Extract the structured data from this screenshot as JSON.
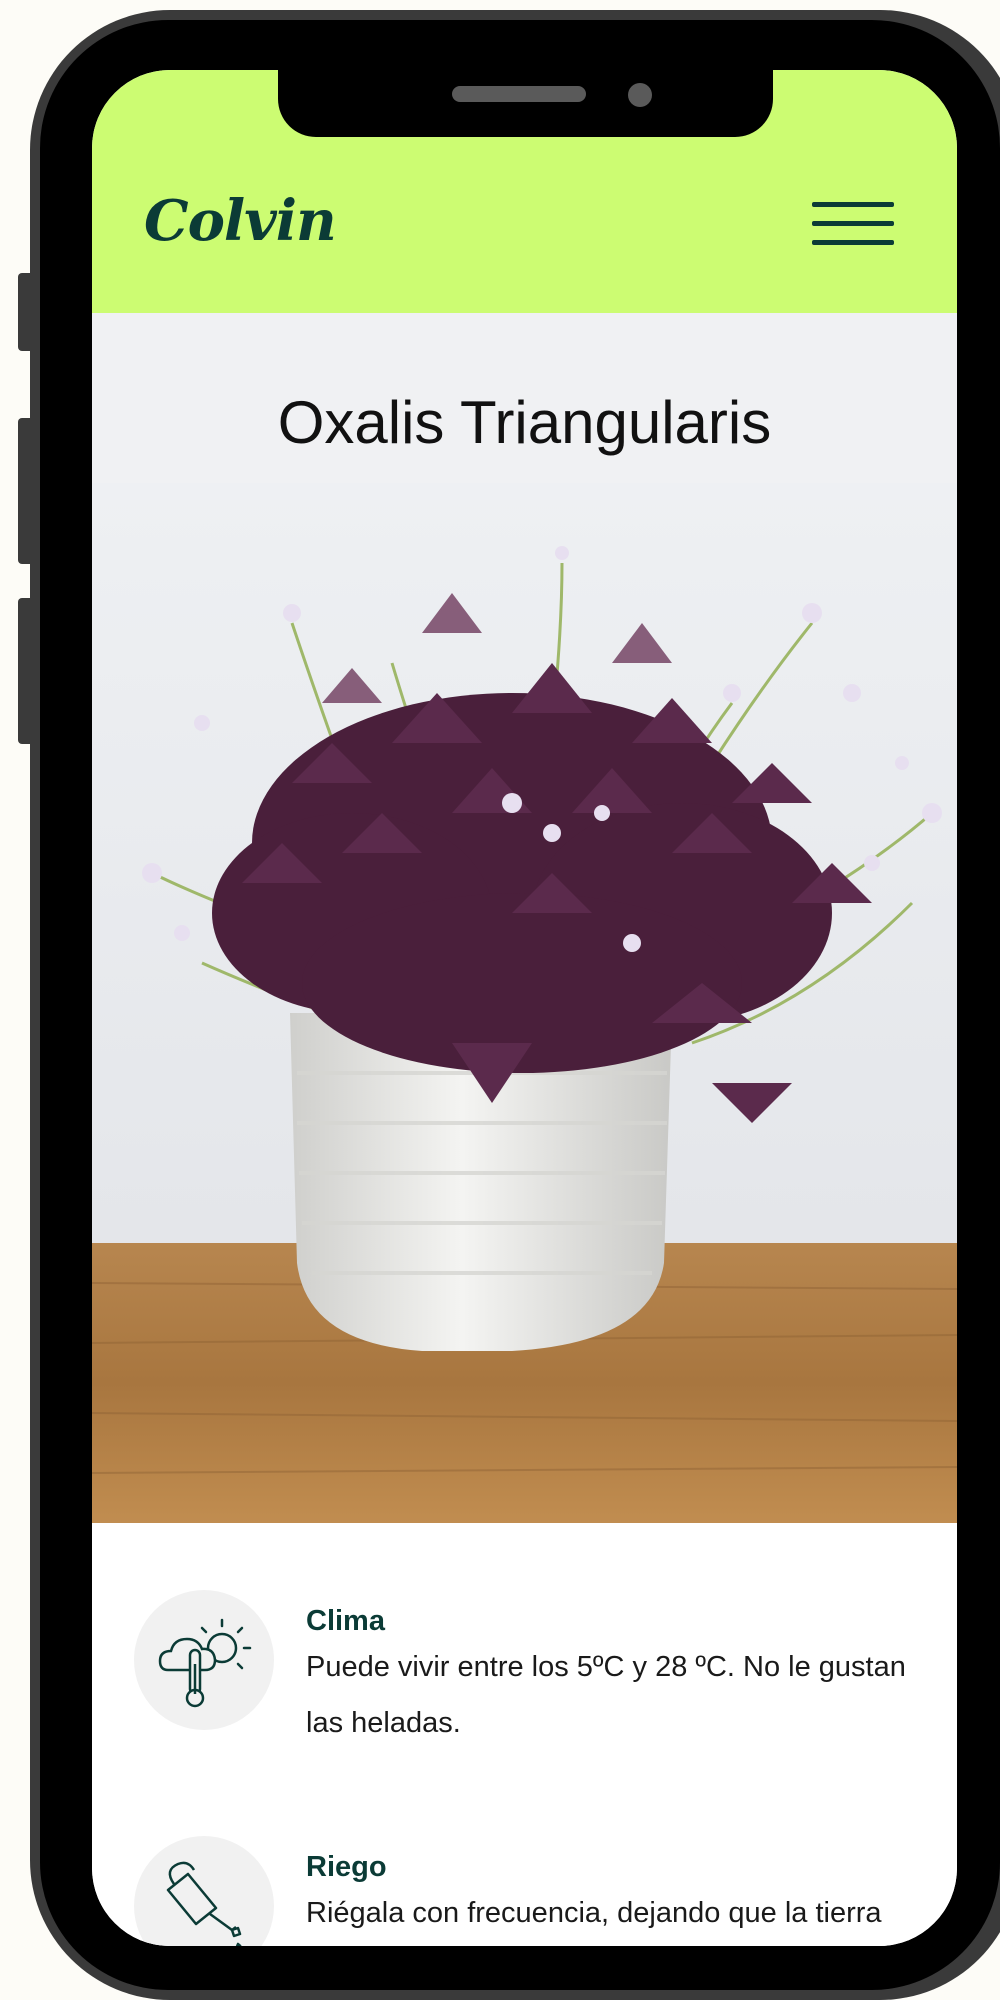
{
  "header": {
    "logo": "Colvin",
    "menu_icon": "hamburger-menu-icon"
  },
  "page": {
    "title": "Oxalis Triangularis"
  },
  "colors": {
    "header_bg": "#ccfc72",
    "brand_dark": "#0b3b36",
    "icon_circle_bg": "#f1f1f1"
  },
  "care": [
    {
      "title": "Clima",
      "text": "Puede vivir entre los 5ºC y 28 ºC. No le gustan las heladas.",
      "icon": "climate-thermometer-sun-icon"
    },
    {
      "title": "Riego",
      "text": "Riégala con frecuencia, dejando que la tierra se seque ligeramente antes del",
      "icon": "watering-can-icon"
    }
  ]
}
